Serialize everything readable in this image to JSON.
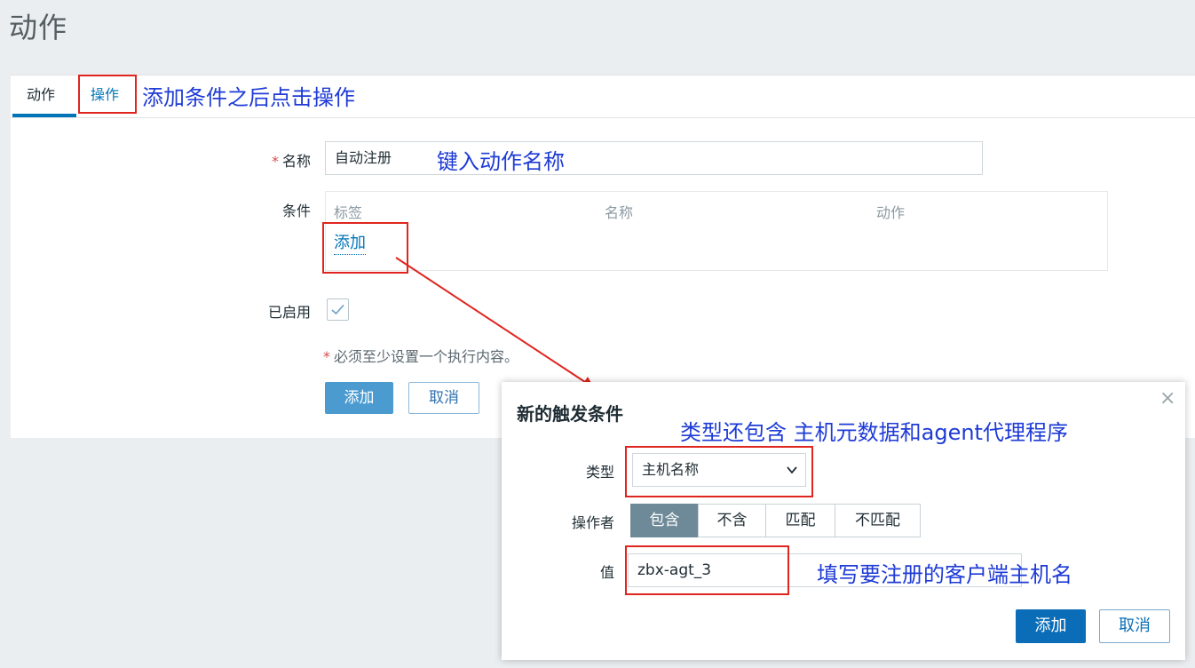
{
  "page": {
    "title": "动作"
  },
  "tabs": {
    "action": "动作",
    "operations": "操作"
  },
  "annotations": {
    "after_conditions": "添加条件之后点击操作",
    "enter_name": "键入动作名称",
    "type_includes": "类型还包含 主机元数据和agent代理程序",
    "fill_hostname": "填写要注册的客户端主机名"
  },
  "form": {
    "name_label": "名称",
    "name_value": "自动注册",
    "conditions_label": "条件",
    "conditions_columns": [
      "标签",
      "名称",
      "动作"
    ],
    "add_condition_link": "添加",
    "enabled_label": "已启用",
    "enabled": true,
    "note": "必须至少设置一个执行内容。",
    "add_button": "添加",
    "cancel_button": "取消"
  },
  "dialog": {
    "title": "新的触发条件",
    "type_label": "类型",
    "type_value": "主机名称",
    "operator_label": "操作者",
    "operators": [
      "包含",
      "不含",
      "匹配",
      "不匹配"
    ],
    "operator_selected": "包含",
    "value_label": "值",
    "value": "zbx-agt_3",
    "add_button": "添加",
    "cancel_button": "取消",
    "close": "×"
  },
  "colors": {
    "link": "#0275b8",
    "annotation": "#1e3bd6",
    "highlight_box": "#e0251f",
    "arrow": "#e0251f"
  }
}
